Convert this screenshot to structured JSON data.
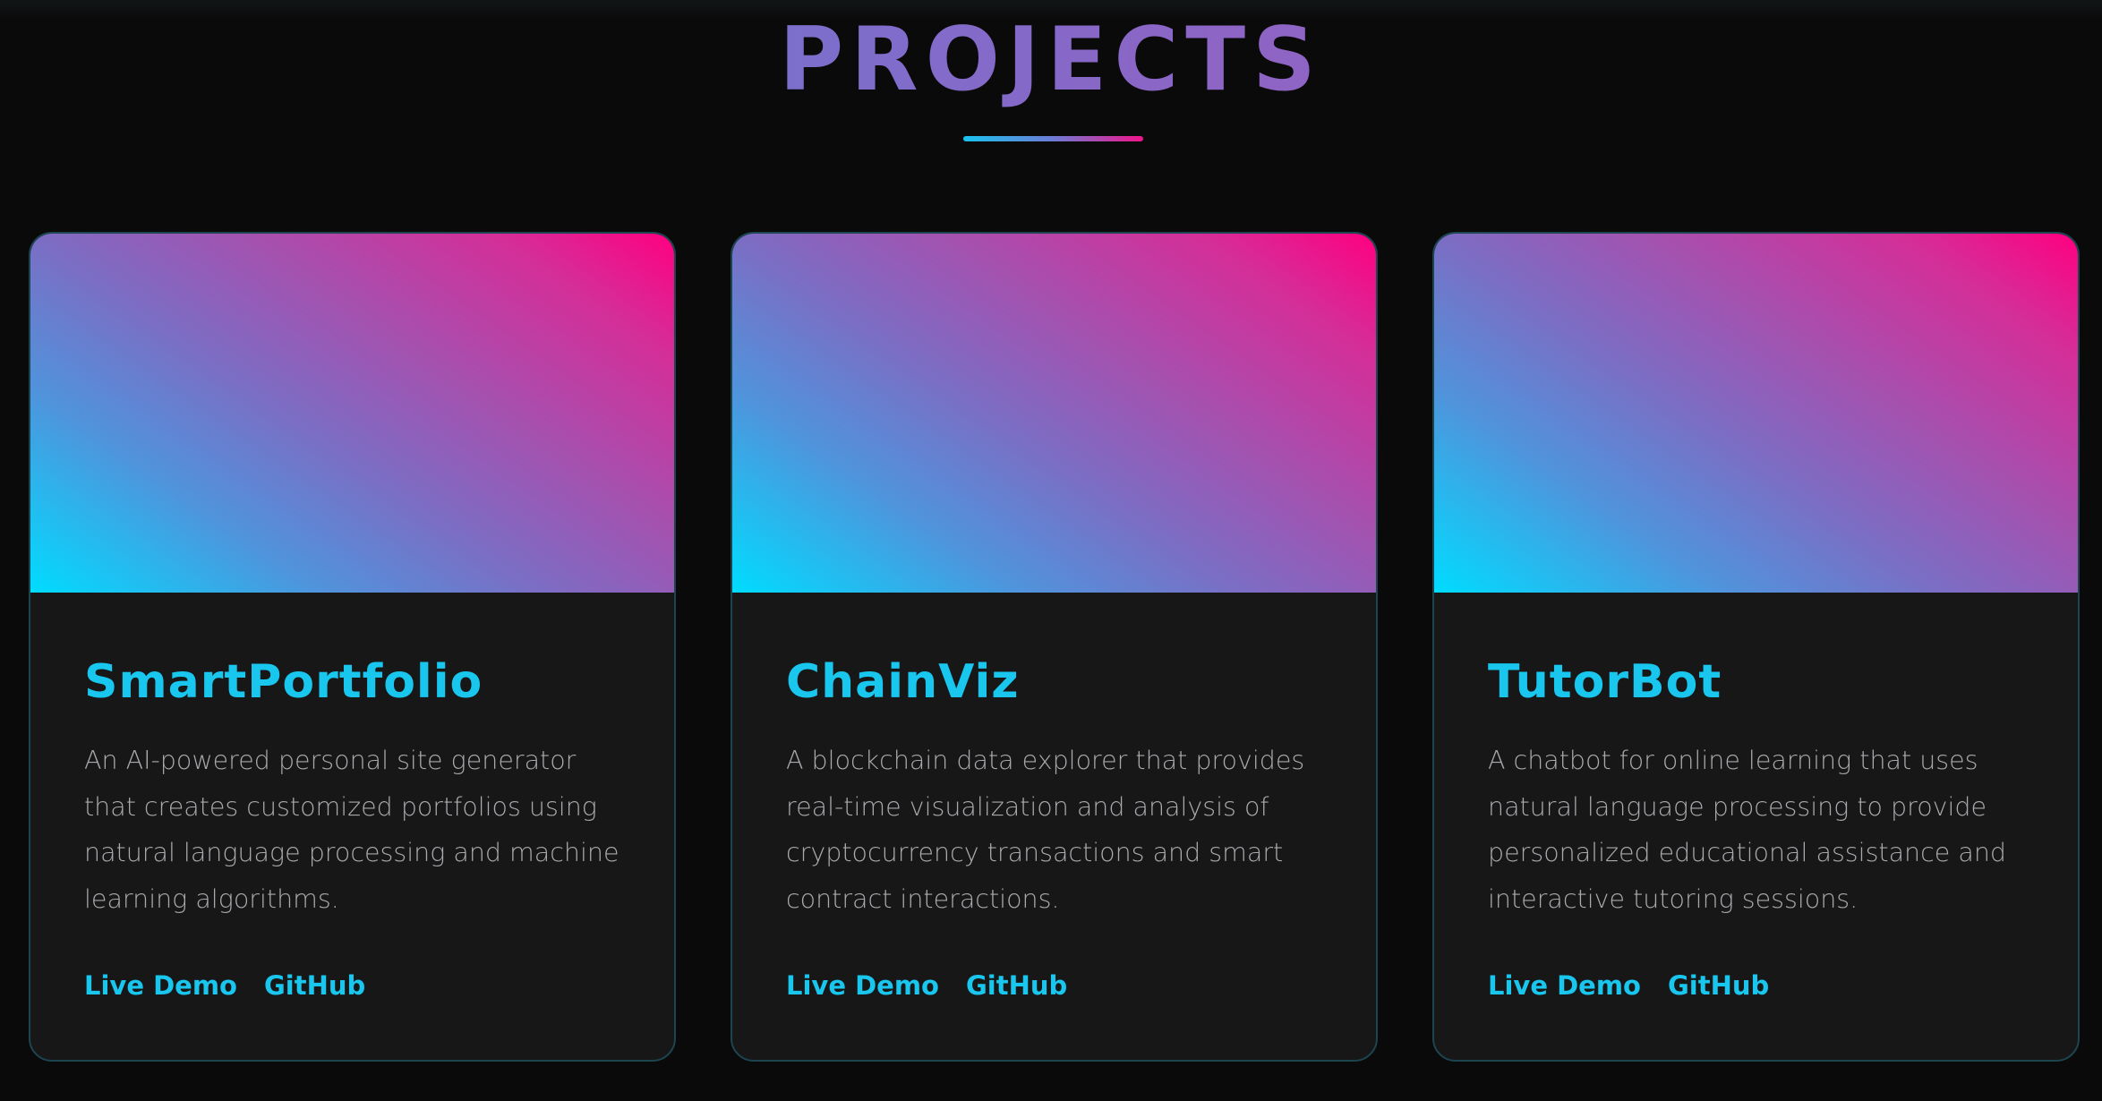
{
  "section": {
    "title": "PROJECTS"
  },
  "colors": {
    "background": "#0a0a0b",
    "card_background": "#171718",
    "card_border": "#1d4550",
    "accent_cyan": "#19c6ee",
    "accent_pink": "#ff0080",
    "accent_purple": "#8a66c6",
    "body_text": "#a9aaad"
  },
  "projects": [
    {
      "title": "SmartPortfolio",
      "description": "An AI-powered personal site generator that creates customized portfolios using natural language processing and machine learning algorithms.",
      "live_demo_label": "Live Demo",
      "github_label": "GitHub"
    },
    {
      "title": "ChainViz",
      "description": "A blockchain data explorer that provides real-time visualization and analysis of cryptocurrency transactions and smart contract interactions.",
      "live_demo_label": "Live Demo",
      "github_label": "GitHub"
    },
    {
      "title": "TutorBot",
      "description": "A chatbot for online learning that uses natural language processing to provide personalized educational assistance and interactive tutoring sessions.",
      "live_demo_label": "Live Demo",
      "github_label": "GitHub"
    }
  ]
}
